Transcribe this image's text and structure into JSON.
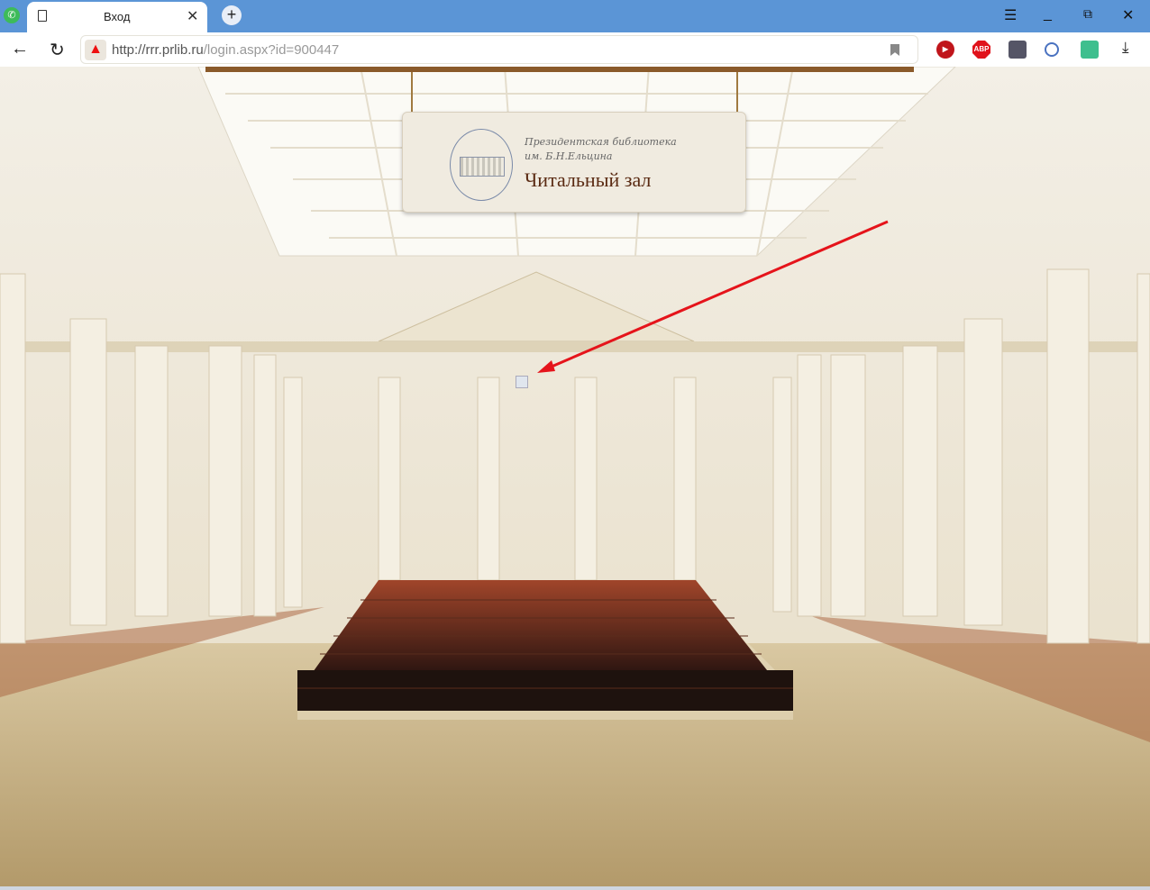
{
  "browser": {
    "tab_title": "Вход",
    "url_domain": "http://rrr.prlib.ru",
    "url_path": "/login.aspx?id=900447",
    "extensions": [
      {
        "name": "youtube-ext",
        "label": "▶",
        "color": "#c0151b"
      },
      {
        "name": "adblock-plus",
        "label": "ABP",
        "color": "#e0121b"
      },
      {
        "name": "map-ext",
        "label": "",
        "color": "#556"
      },
      {
        "name": "search-ext",
        "label": "",
        "color": "#ccc"
      },
      {
        "name": "bulb-ext",
        "label": "",
        "color": "#3ebf8e"
      }
    ]
  },
  "page": {
    "sign_line1": "Президентская библиотека",
    "sign_line2": "им. Б.Н.Ельцина",
    "sign_title": "Читальный зал"
  }
}
